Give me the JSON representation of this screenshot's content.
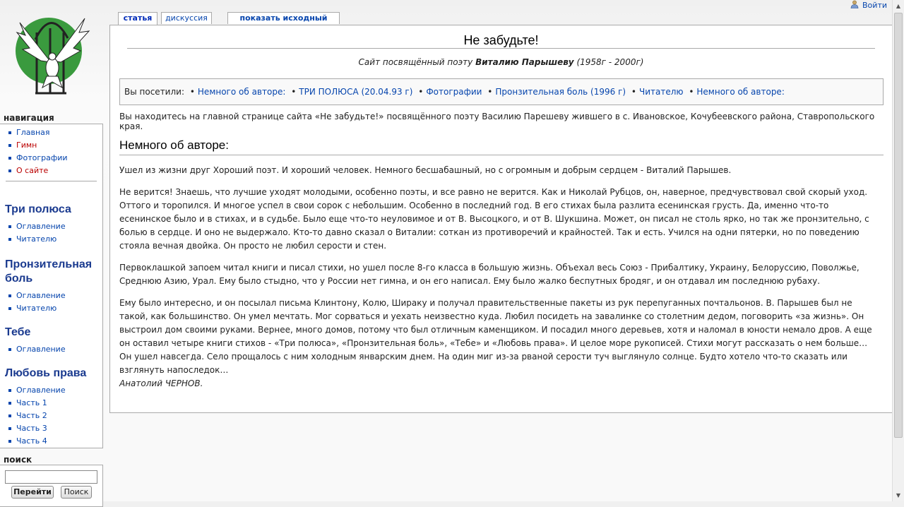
{
  "personal": {
    "login_label": "Войти"
  },
  "tabs": {
    "article": "статья",
    "discussion": "дискуссия",
    "view_source": "показать исходный текст"
  },
  "page": {
    "title": "Не забудьте!",
    "site_sub_prefix": "Сайт посвящённый поэту ",
    "site_sub_name": "Виталию Парышеву",
    "site_sub_years": " (1958г - 2000г)",
    "visited_label": "Вы посетили:",
    "visited_links": [
      "Немного об авторе:",
      "ТРИ ПОЛЮСА (20.04.93 г)",
      "Фотографии",
      "Пронзительная боль (1996 г)",
      "Читателю",
      "Немного об авторе:"
    ],
    "intro": "Вы находитесь на главной странице сайта «Не забудьте!» посвящённого поэту Василию Парешеву жившего в с. Ивановское, Кочубеевского района, Ставропольского края.",
    "section_heading": "Немного об авторе:",
    "paragraphs": [
      "Ушел из жизни друг Хороший поэт. И хороший человек. Немного бесшабашный, но с огромным и добрым сердцем - Виталий Парышев.",
      "Не верится! Знаешь, что лучшие уходят молодыми, особенно поэты, и все равно не верится. Как и Николай Рубцов, он, наверное, предчувствовал свой скорый уход. Оттого и торопился. И многое успел в свои сорок с небольшим. Особенно в последний год. В его стихах была разлита есенинская грусть. Да, именно что-то есенинское было и в стихах, и в судьбе. Было еще что-то неуловимое и от В. Высоцкого, и от В. Шукшина. Может, он писал не столь ярко, но так же пронзительно, с болью в сердце. И оно не выдержало. Кто-то давно сказал о Виталии: соткан из противоречий и крайностей. Так и есть. Учился на одни пятерки, но по поведению стояла вечная двойка. Он просто не любил серости и стен.",
      "Первоклашкой запоем читал книги и писал стихи, но ушел после 8-го класса в большую жизнь. Объехал весь Союз - Прибалтику, Украину, Белоруссию, Поволжье, Среднюю Азию, Урал. Ему было стыдно, что у России нет гимна, и он его написал. Ему было жалко беспутных бродяг, и он отдавал им последнюю рубаху.",
      "Ему было интересно, и он посылал письма Клинтону, Колю, Шираку и получал правительственные пакеты из рук перепуганных почтальонов. В. Парышев был не такой, как большинство. Он умел мечтать. Мог сорваться и уехать неизвестно куда. Любил посидеть на завалинке со столетним дедом, поговорить «за жизнь». Он выстроил дом своими руками. Вернее, много домов, потому что был отличным каменщиком. И посадил много деревьев, хотя и наломал в юности немало дров. А еще он оставил четыре книги стихов - «Три полюса», «Пронзительная боль», «Тебе» и «Любовь права». И целое море рукописей. Стихи могут рассказать о нем больше… Он ушел навсегда. Село прощалось с ним холодным январским днем. На один миг из-за рваной серости туч выглянуло солнце. Будто хотело что-то сказать или взглянуть напоследок…"
    ],
    "signature": "Анатолий ЧЕРНОВ."
  },
  "sidebar": {
    "nav_title": "навигация",
    "nav_items": [
      {
        "label": "Главная",
        "missing": false
      },
      {
        "label": "Гимн",
        "missing": true
      },
      {
        "label": "Фотографии",
        "missing": false
      },
      {
        "label": "О сайте",
        "missing": true
      }
    ],
    "sections": [
      {
        "heading": "Три полюса",
        "items": [
          "Оглавление",
          "Читателю"
        ]
      },
      {
        "heading": "Пронзительная боль",
        "items": [
          "Оглавление",
          "Читателю"
        ]
      },
      {
        "heading": "Тебе",
        "items": [
          "Оглавление"
        ]
      },
      {
        "heading": "Любовь права",
        "items": [
          "Оглавление",
          "Часть 1",
          "Часть 2",
          "Часть 3",
          "Часть 4"
        ]
      }
    ],
    "search_title": "поиск",
    "search_value": "",
    "go_button": "Перейти",
    "search_button": "Поиск"
  },
  "colors": {
    "link": "#0645ad",
    "missing_link": "#ba0000",
    "sidebar_heading": "#1a3a8f",
    "logo_green": "#3a9a3e"
  },
  "icons": [
    "user-icon",
    "logo-dove-emblem"
  ]
}
